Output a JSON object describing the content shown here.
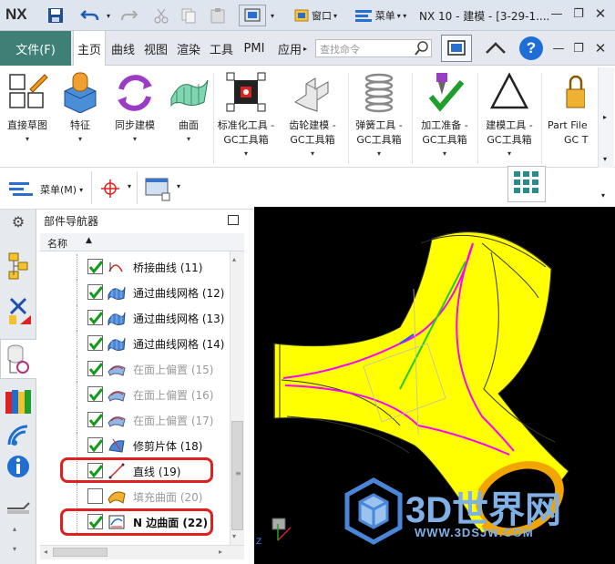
{
  "titlebar": {
    "logo": "NX",
    "menu_label": "菜单",
    "window_label": "窗口",
    "title": "NX 10 - 建模 - [3-29-1...."
  },
  "menubar": {
    "file_tab": "文件(F)",
    "tabs": [
      "主页",
      "曲线",
      "视图",
      "渲染",
      "工具",
      "PMI",
      "应用"
    ],
    "search_placeholder": "查找命令"
  },
  "ribbon": {
    "buttons": [
      {
        "label": "直接草图",
        "label2": ""
      },
      {
        "label": "特征",
        "label2": ""
      },
      {
        "label": "同步建模",
        "label2": ""
      },
      {
        "label": "曲面",
        "label2": ""
      },
      {
        "label": "标准化工具 -",
        "label2": "GC工具箱"
      },
      {
        "label": "齿轮建模 -",
        "label2": "GC工具箱"
      },
      {
        "label": "弹簧工具 -",
        "label2": "GC工具箱"
      },
      {
        "label": "加工准备 -",
        "label2": "GC工具箱"
      },
      {
        "label": "建模工具 -",
        "label2": "GC工具箱"
      },
      {
        "label": "Part File",
        "label2": "GC T"
      }
    ]
  },
  "toolbar2": {
    "menu_label": "菜单(M)"
  },
  "navigator": {
    "title": "部件导航器",
    "column_name": "名称",
    "rows": [
      {
        "label": "桥接曲线 (11)",
        "checked": true,
        "dim": false,
        "bold": false
      },
      {
        "label": "通过曲线网格 (12)",
        "checked": true,
        "dim": false,
        "bold": false
      },
      {
        "label": "通过曲线网格 (13)",
        "checked": true,
        "dim": false,
        "bold": false
      },
      {
        "label": "通过曲线网格 (14)",
        "checked": true,
        "dim": false,
        "bold": false
      },
      {
        "label": "在面上偏置 (15)",
        "checked": true,
        "dim": true,
        "bold": false
      },
      {
        "label": "在面上偏置 (16)",
        "checked": true,
        "dim": true,
        "bold": false
      },
      {
        "label": "在面上偏置 (17)",
        "checked": true,
        "dim": true,
        "bold": false
      },
      {
        "label": "修剪片体 (18)",
        "checked": true,
        "dim": false,
        "bold": false
      },
      {
        "label": "直线 (19)",
        "checked": true,
        "dim": false,
        "bold": false
      },
      {
        "label": "填充曲面 (20)",
        "checked": false,
        "dim": true,
        "bold": false
      },
      {
        "label": "N 边曲面 (22)",
        "checked": true,
        "dim": false,
        "bold": true
      }
    ]
  },
  "watermark": {
    "brand": "3D世界网",
    "url": "WWW.3DSJW.COM"
  },
  "colors": {
    "accent": "#3e8076",
    "highlight_red": "#e0201e",
    "model_yellow": "#ffff00",
    "viewport_bg": "#000000"
  }
}
